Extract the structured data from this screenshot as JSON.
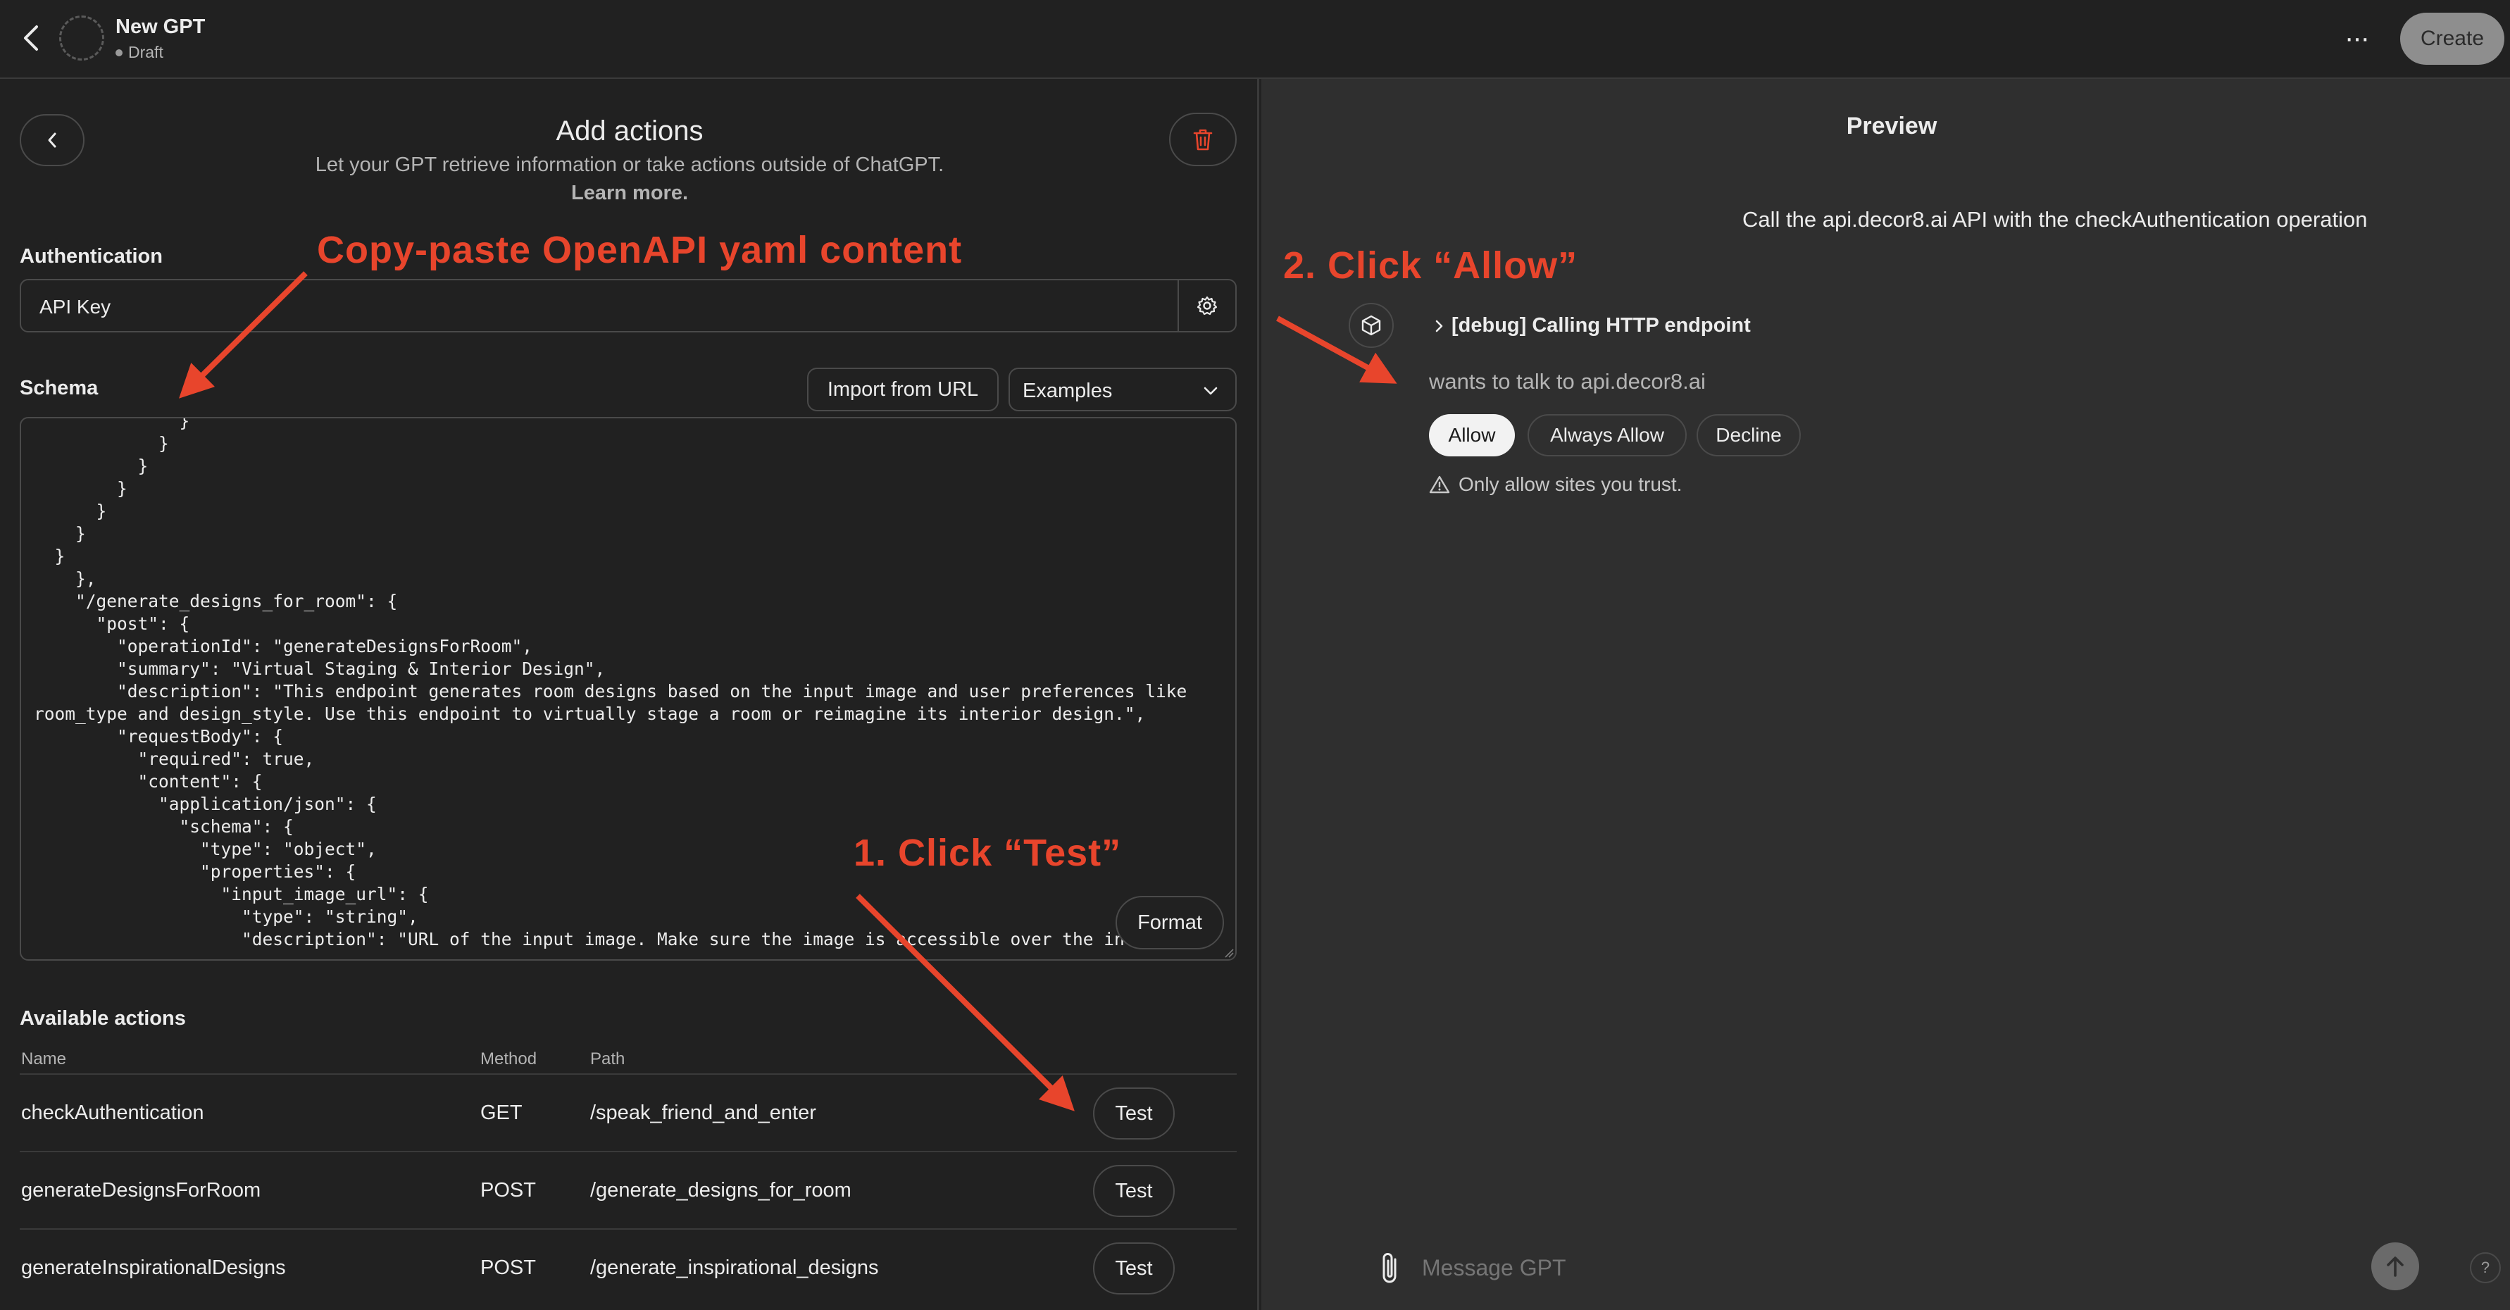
{
  "topbar": {
    "gpt_name": "New GPT",
    "gpt_status": "Draft",
    "more_label": "···",
    "create_label": "Create"
  },
  "editor": {
    "title": "Add actions",
    "subtitle": "Let your GPT retrieve information or take actions outside of ChatGPT.",
    "learn_more": "Learn more.",
    "authentication_label": "Authentication",
    "authentication_value": "API Key",
    "schema_label": "Schema",
    "import_label": "Import from URL",
    "examples_label": "Examples",
    "schema_text": "              }\n            }\n          }\n        }\n      }\n    }\n  }\n    },\n    \"/generate_designs_for_room\": {\n      \"post\": {\n        \"operationId\": \"generateDesignsForRoom\",\n        \"summary\": \"Virtual Staging & Interior Design\",\n        \"description\": \"This endpoint generates room designs based on the input image and user preferences like\nroom_type and design_style. Use this endpoint to virtually stage a room or reimagine its interior design.\",\n        \"requestBody\": {\n          \"required\": true,\n          \"content\": {\n            \"application/json\": {\n              \"schema\": {\n                \"type\": \"object\",\n                \"properties\": {\n                  \"input_image_url\": {\n                    \"type\": \"string\",\n                    \"description\": \"URL of the input image. Make sure the image is accessible over the internet",
    "format_label": "Format",
    "available_actions_label": "Available actions",
    "columns": [
      "Name",
      "Method",
      "Path"
    ],
    "actions": [
      {
        "name": "checkAuthentication",
        "method": "GET",
        "path": "/speak_friend_and_enter",
        "test": "Test"
      },
      {
        "name": "generateDesignsForRoom",
        "method": "POST",
        "path": "/generate_designs_for_room",
        "test": "Test"
      },
      {
        "name": "generateInspirationalDesigns",
        "method": "POST",
        "path": "/generate_inspirational_designs",
        "test": "Test"
      }
    ]
  },
  "preview": {
    "title": "Preview",
    "user_message": "Call the api.decor8.ai API with the checkAuthentication operation",
    "debug_label": "[debug] Calling HTTP endpoint",
    "wants_text": "wants to talk to api.decor8.ai",
    "allow_label": "Allow",
    "always_allow_label": "Always Allow",
    "decline_label": "Decline",
    "trust_text": "Only allow sites you trust.",
    "message_placeholder": "Message GPT",
    "help_label": "?"
  },
  "annotations": {
    "copy_paste": "Copy-paste OpenAPI yaml content",
    "click_test": "1. Click “Test”",
    "click_allow": "2. Click “Allow”",
    "color": "#e8452c"
  },
  "icons": {
    "back": "chevron-left-icon",
    "trash": "trash-icon",
    "gear": "gear-icon",
    "chevron_down": "chevron-down-icon",
    "cube": "cube-icon",
    "warning": "warning-icon",
    "paperclip": "paperclip-icon",
    "send": "arrow-up-icon"
  }
}
